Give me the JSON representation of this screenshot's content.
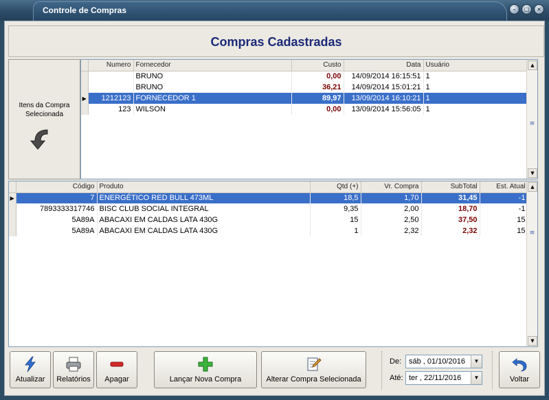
{
  "window": {
    "title": "Controle de Compras"
  },
  "header": {
    "title": "Compras Cadastradas"
  },
  "left_panel": {
    "label_line1": "Itens da Compra",
    "label_line2": "Selecionada"
  },
  "purchases": {
    "columns": [
      "Numero",
      "Fornecedor",
      "Custo",
      "Data",
      "Usuário"
    ],
    "rows": [
      {
        "numero": "",
        "fornecedor": "BRUNO",
        "custo": "0,00",
        "data": "14/09/2014 16:15:51",
        "usuario": "1"
      },
      {
        "numero": "",
        "fornecedor": "BRUNO",
        "custo": "36,21",
        "data": "14/09/2014 15:01:21",
        "usuario": "1"
      },
      {
        "numero": "1212123",
        "fornecedor": "FORNECEDOR 1",
        "custo": "89,97",
        "data": "13/09/2014 16:10:21",
        "usuario": "1"
      },
      {
        "numero": "123",
        "fornecedor": "WILSON",
        "custo": "0,00",
        "data": "13/09/2014 15:56:05",
        "usuario": "1"
      }
    ],
    "selected_index": 2
  },
  "items": {
    "columns": [
      "Código",
      "Produto",
      "Qtd (+)",
      "Vr. Compra",
      "SubTotal",
      "Est. Atual"
    ],
    "rows": [
      {
        "codigo": "7",
        "produto": "ENERGÉTICO RED BULL 473ML",
        "qtd": "18,5",
        "vr_compra": "1,70",
        "subtotal": "31,45",
        "est_atual": "-1"
      },
      {
        "codigo": "7893333317746",
        "produto": "BISC CLUB SOCIAL INTEGRAL",
        "qtd": "9,35",
        "vr_compra": "2,00",
        "subtotal": "18,70",
        "est_atual": "-1"
      },
      {
        "codigo": "5A89A",
        "produto": "ABACAXI EM CALDAS LATA 430G",
        "qtd": "15",
        "vr_compra": "2,50",
        "subtotal": "37,50",
        "est_atual": "15"
      },
      {
        "codigo": "5A89A",
        "produto": "ABACAXI EM CALDAS LATA 430G",
        "qtd": "1",
        "vr_compra": "2,32",
        "subtotal": "2,32",
        "est_atual": "15"
      }
    ],
    "selected_index": 0
  },
  "toolbar": {
    "atualizar": "Atualizar",
    "relatorios": "Relatórios",
    "apagar": "Apagar",
    "lancar": "Lançar Nova Compra",
    "alterar": "Alterar Compra Selecionada",
    "voltar": "Voltar"
  },
  "dates": {
    "de_label": "De:",
    "de_value": "sáb , 01/10/2016",
    "ate_label": "Até:",
    "ate_value": "ter , 22/11/2016"
  },
  "colors": {
    "selection": "#3a6fc9",
    "money": "#7a0000",
    "title": "#1b2a78"
  }
}
